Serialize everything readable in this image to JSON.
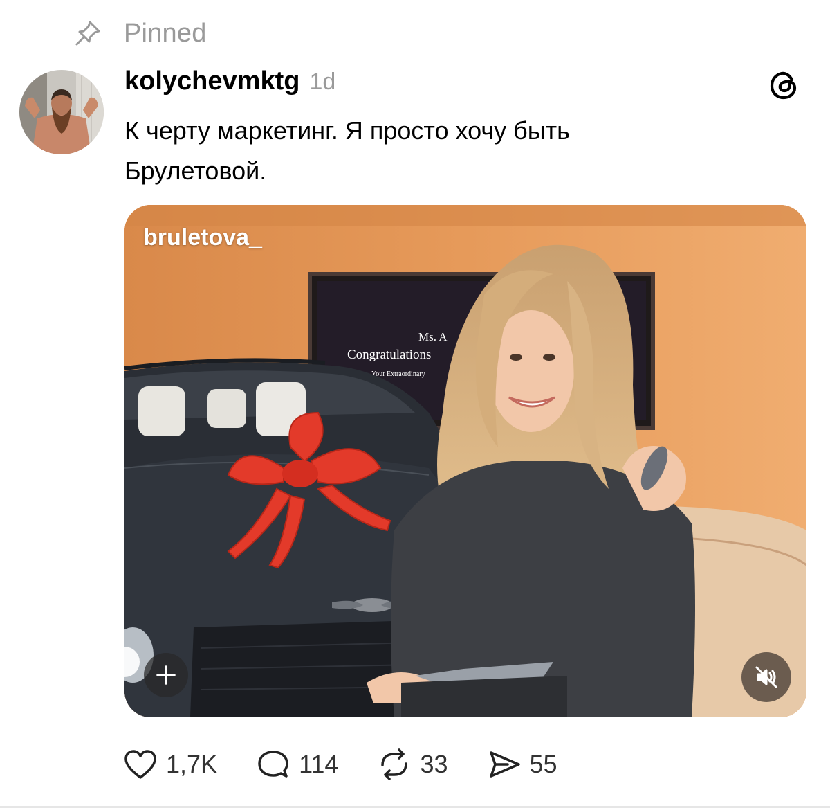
{
  "pinned": {
    "label": "Pinned",
    "icon": "pin-icon"
  },
  "post": {
    "username": "kolychevmktg",
    "timestamp": "1d",
    "text_lines": [
      "К черту маркетинг. Я просто хочу быть",
      "Брулетовой."
    ],
    "app_logo": "threads-logo-icon",
    "media": {
      "handle_overlay": "bruletova_",
      "screen_text": [
        "Ms. A",
        "Congratulations",
        "Your Extraordinary"
      ],
      "add_icon": "plus-icon",
      "mute_icon": "muted-speaker-icon"
    },
    "actions": {
      "likes": "1,7K",
      "replies": "114",
      "reposts": "33",
      "shares": "55"
    }
  },
  "colors": {
    "text_primary": "#000000",
    "text_secondary": "#9a9a9a",
    "action_text": "#333333",
    "media_background": "#d98a4a"
  }
}
